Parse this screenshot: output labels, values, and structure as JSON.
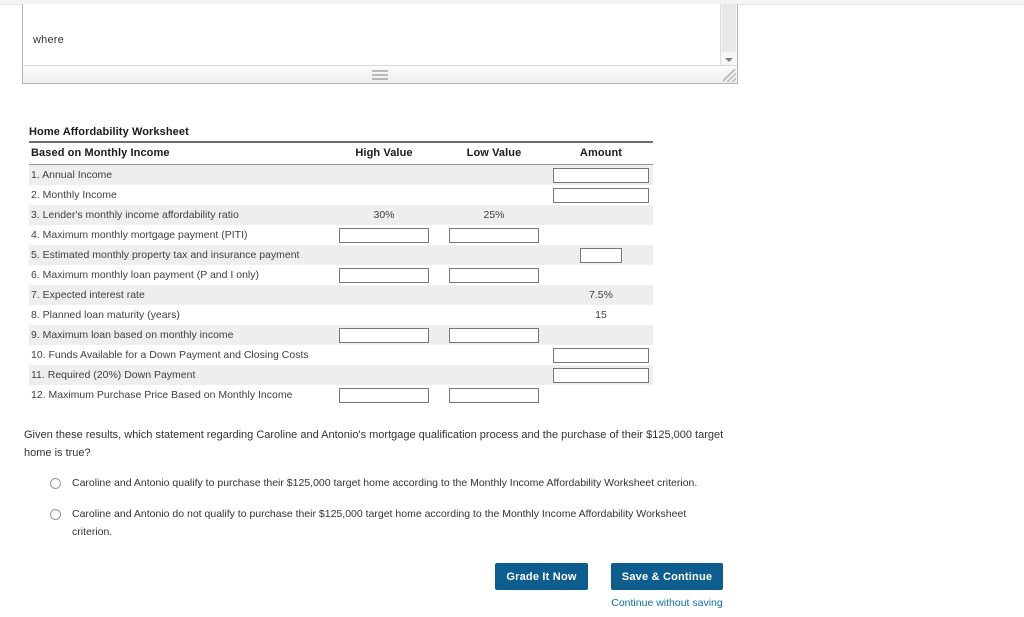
{
  "editor": {
    "text": "where",
    "scrollbar_name": "vertical-scrollbar",
    "resize_handle_name": "resize-handle"
  },
  "worksheet": {
    "title": "Home Affordability Worksheet",
    "columns": {
      "label": "Based on Monthly Income",
      "high": "High Value",
      "low": "Low Value",
      "amount": "Amount"
    },
    "rows": [
      {
        "label": "1. Annual Income",
        "high": "",
        "low": "",
        "amount": "",
        "high_type": "none",
        "low_type": "none",
        "amount_type": "input",
        "shaded": true
      },
      {
        "label": "2. Monthly Income",
        "high": "",
        "low": "",
        "amount": "",
        "high_type": "none",
        "low_type": "none",
        "amount_type": "input",
        "shaded": false
      },
      {
        "label": "3. Lender's monthly income affordability ratio",
        "high": "30%",
        "low": "25%",
        "amount": "",
        "high_type": "text",
        "low_type": "text",
        "amount_type": "none",
        "shaded": true
      },
      {
        "label": "4. Maximum monthly mortgage payment (PITI)",
        "high": "",
        "low": "",
        "amount": "",
        "high_type": "input",
        "low_type": "input",
        "amount_type": "none",
        "shaded": false
      },
      {
        "label": "5. Estimated monthly property tax and insurance payment",
        "high": "",
        "low": "",
        "amount": "",
        "high_type": "none",
        "low_type": "none",
        "amount_type": "input-narrow",
        "shaded": true
      },
      {
        "label": "6. Maximum monthly loan payment (P and I only)",
        "high": "",
        "low": "",
        "amount": "",
        "high_type": "input",
        "low_type": "input",
        "amount_type": "none",
        "shaded": false
      },
      {
        "label": "7. Expected interest rate",
        "high": "",
        "low": "",
        "amount": "7.5%",
        "high_type": "none",
        "low_type": "none",
        "amount_type": "text",
        "shaded": true
      },
      {
        "label": "8. Planned loan maturity (years)",
        "high": "",
        "low": "",
        "amount": "15",
        "high_type": "none",
        "low_type": "none",
        "amount_type": "text",
        "shaded": false
      },
      {
        "label": "9. Maximum loan based on monthly income",
        "high": "",
        "low": "",
        "amount": "",
        "high_type": "input",
        "low_type": "input",
        "amount_type": "none",
        "shaded": true
      },
      {
        "label": "10. Funds Available for a Down Payment and Closing Costs",
        "high": "",
        "low": "",
        "amount": "",
        "high_type": "none",
        "low_type": "none",
        "amount_type": "input",
        "shaded": false
      },
      {
        "label": "11. Required (20%) Down Payment",
        "high": "",
        "low": "",
        "amount": "",
        "high_type": "none",
        "low_type": "none",
        "amount_type": "input",
        "shaded": true
      },
      {
        "label": "12. Maximum Purchase Price Based on Monthly Income",
        "high": "",
        "low": "",
        "amount": "",
        "high_type": "input",
        "low_type": "input",
        "amount_type": "none",
        "shaded": false
      }
    ]
  },
  "question": {
    "text": "Given these results, which statement regarding Caroline and Antonio's mortgage qualification process and the purchase of their $125,000 target home is true?",
    "options": [
      "Caroline and Antonio qualify to purchase their $125,000 target home according to the Monthly Income Affordability Worksheet criterion.",
      "Caroline and Antonio do not qualify to purchase their $125,000 target home according to the Monthly Income Affordability Worksheet criterion."
    ]
  },
  "actions": {
    "grade_label": "Grade It Now",
    "save_label": "Save & Continue",
    "continue_link": "Continue without saving",
    "button_color": "#0e5d8f",
    "link_color": "#0e6da8"
  }
}
